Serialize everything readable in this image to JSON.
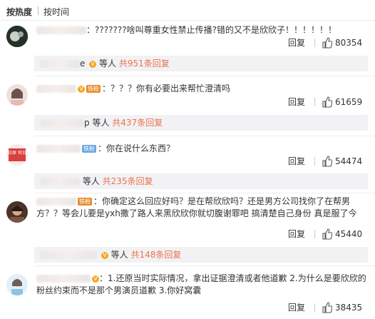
{
  "tabs": [
    "按热度",
    "按时间"
  ],
  "comments": [
    {
      "text": "：???????啥叫尊重女性禁止传播?错的又不是欣欣子！！！！！！",
      "reply_label": "回复",
      "likes": "80354",
      "sub": {
        "prefix": "e",
        "people": "等人",
        "more": "共951条回复"
      }
    },
    {
      "level": "铁粉",
      "text": "：？？？你有必要出来帮忙澄清吗",
      "reply_label": "回复",
      "likes": "61659",
      "sub": {
        "prefix": "p",
        "people": "等人",
        "more": "共437条回复"
      }
    },
    {
      "avatar_text": "转日原 何日原",
      "level": "铁粉",
      "text": "：你在说什么东西？",
      "reply_label": "回复",
      "likes": "54474",
      "sub": {
        "prefix": "",
        "people": "等人",
        "more": "共235条回复"
      }
    },
    {
      "level": "铁粉",
      "text": "：你确定这么回应好吗？是在帮欣欣吗？还是男方公司找你了在帮男方？？等会儿要是yxh撒了路人来黑欣欣你就切腹谢罪吧 搞清楚自己身份 真是服了今",
      "reply_label": "回复",
      "likes": "45440",
      "sub": {
        "prefix": "",
        "people": "等人",
        "more": "共148条回复"
      }
    },
    {
      "text": "：1.还原当时实际情况，拿出证据澄清或者他道歉 2.为什么是要欣欣的粉丝约束而不是那个男演员道歉 3.你好窝囊",
      "reply_label": "回复",
      "likes": "38435"
    }
  ],
  "colors": {
    "link": "#eb7350",
    "text": "#333333",
    "badge": "#f5a623"
  }
}
